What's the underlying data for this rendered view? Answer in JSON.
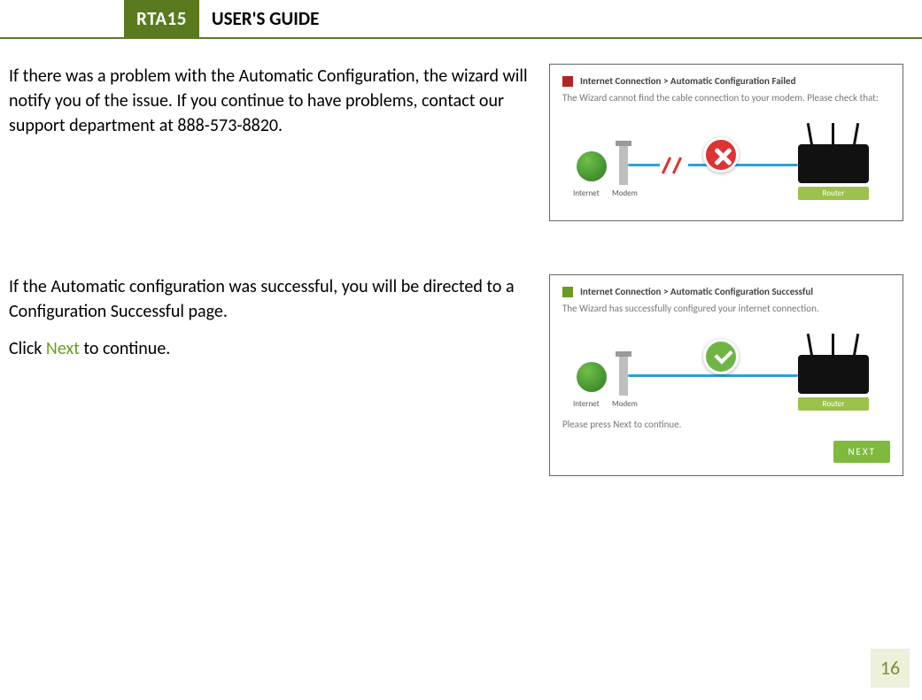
{
  "header": {
    "tag": "RTA15",
    "title": "USER'S GUIDE"
  },
  "section1": {
    "body": "If there was a problem with the Automatic Configuration, the wizard will notify you of the issue.  If you continue to have problems, contact our support department at 888-573-8820.",
    "panel": {
      "title": "Internet Connection > Automatic Configuration Failed",
      "subtitle": "The Wizard cannot find the cable connection to your modem. Please check that:",
      "labels": {
        "internet": "Internet",
        "modem": "Modem",
        "router": "Router"
      }
    }
  },
  "section2": {
    "body1": "If the Automatic configuration was successful, you will be directed to a Configuration Successful page.",
    "body2_pre": "Click ",
    "body2_link": "Next",
    "body2_post": " to continue.",
    "panel": {
      "title": "Internet Connection > Automatic Configuration Successful",
      "subtitle": "The Wizard has successfully configured your internet connection.",
      "footer": "Please press Next to continue.",
      "next": "NEXT",
      "labels": {
        "internet": "Internet",
        "modem": "Modem",
        "router": "Router"
      }
    }
  },
  "page_number": "16"
}
